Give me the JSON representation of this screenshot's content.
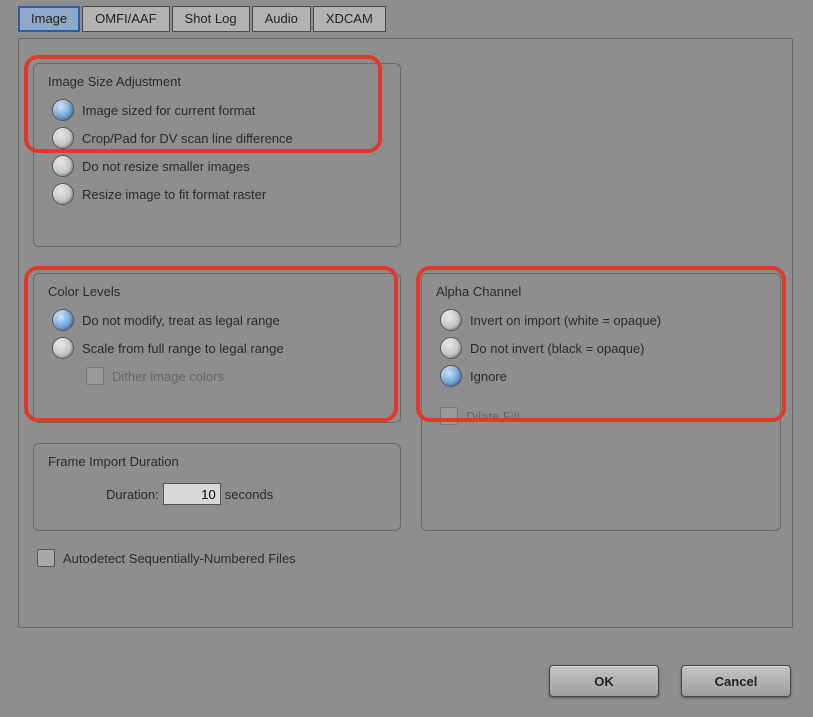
{
  "tabs": {
    "image": "Image",
    "omfiaaf": "OMFI/AAF",
    "shotlog": "Shot Log",
    "audio": "Audio",
    "xdcam": "XDCAM"
  },
  "imageSize": {
    "title": "Image Size Adjustment",
    "opt1": "Image sized for current format",
    "opt2": "Crop/Pad for DV scan line difference",
    "opt3": "Do not resize smaller images",
    "opt4": "Resize image to fit format raster"
  },
  "colorLevels": {
    "title": "Color Levels",
    "opt1": "Do not modify, treat as legal range",
    "opt2": "Scale from full range to legal range",
    "dither": "Dither image colors"
  },
  "alpha": {
    "title": "Alpha Channel",
    "opt1": "Invert on import (white = opaque)",
    "opt2": "Do not invert (black = opaque)",
    "opt3": "Ignore",
    "dilate": "Dilate Fill"
  },
  "frameImport": {
    "title": "Frame Import Duration",
    "durationLabel": "Duration:",
    "durationValue": "10",
    "unit": "seconds"
  },
  "autodetect": "Autodetect Sequentially-Numbered Files",
  "buttons": {
    "ok": "OK",
    "cancel": "Cancel"
  }
}
